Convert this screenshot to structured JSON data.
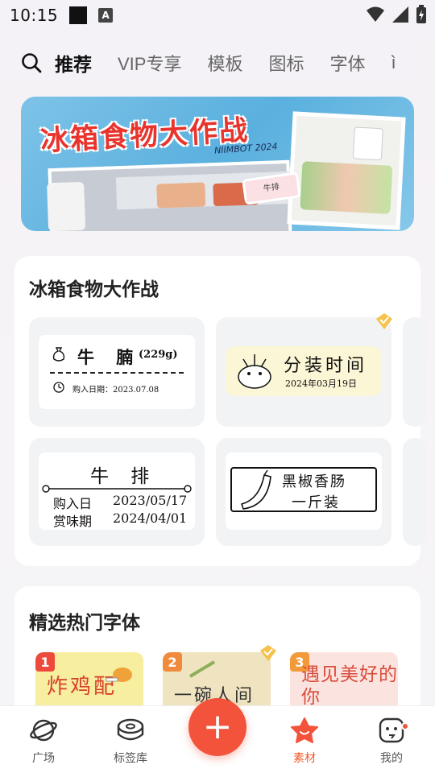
{
  "status": {
    "time": "10:15",
    "a_icon": "A"
  },
  "nav": {
    "tabs": [
      "推荐",
      "VIP专享",
      "模板",
      "图标",
      "字体",
      "ì"
    ]
  },
  "banner": {
    "title": "冰箱食物大作战",
    "subtitle": "NIIMBOT 2024",
    "sticker_text": "牛排"
  },
  "section1": {
    "title": "冰箱食物大作战",
    "templates": [
      {
        "line1": "牛 腩",
        "weight": "(229g)",
        "line2": "购入日期：2023.07.08"
      },
      {
        "line1": "分装时间",
        "line2": "2024年03月19日"
      },
      {
        "title": "牛 排",
        "row1_label": "购入日",
        "row1_value": "2023/05/17",
        "row2_label": "赏味期",
        "row2_value": "2024/04/01"
      },
      {
        "line1": "黑椒香肠",
        "line2": "一斤装"
      }
    ]
  },
  "section2": {
    "title": "精选热门字体",
    "fonts": [
      {
        "rank": "1",
        "sample": "炸鸡配"
      },
      {
        "rank": "2",
        "sample": "一碗人间"
      },
      {
        "rank": "3",
        "sample": "遇见美好的你"
      }
    ]
  },
  "bottom": {
    "items": [
      {
        "label": "广场"
      },
      {
        "label": "标签库"
      },
      {
        "label": "素材"
      },
      {
        "label": "我的"
      }
    ],
    "fab": "+"
  },
  "colors": {
    "accent": "#f2533a",
    "active_text": "#f05a28",
    "banner_title": "#e8342d"
  }
}
